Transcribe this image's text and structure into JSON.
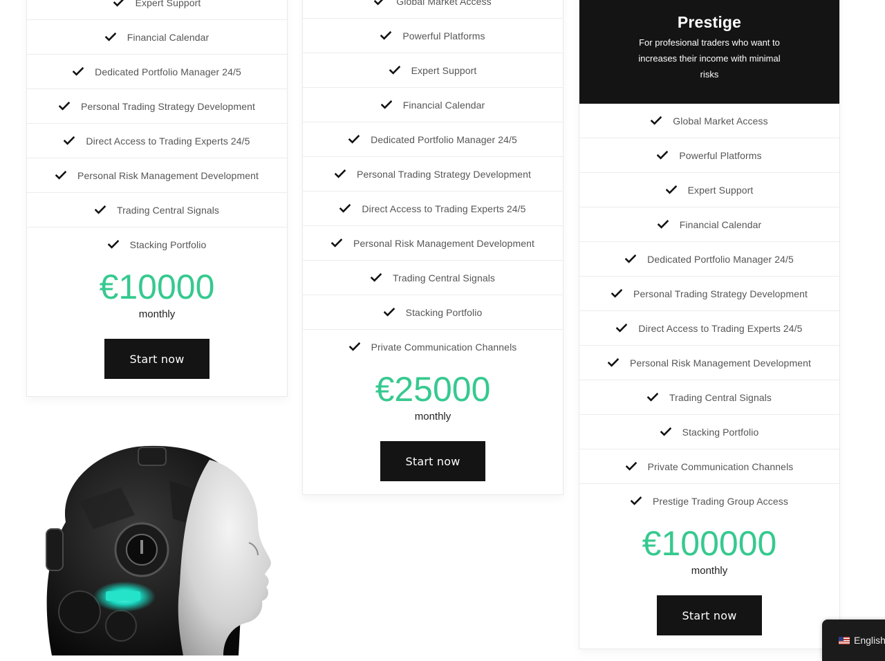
{
  "plans": [
    {
      "features": [
        "Expert Support",
        "Financial Calendar",
        "Dedicated Portfolio Manager 24/5",
        "Personal Trading Strategy Development",
        "Direct Access to Trading Experts 24/5",
        "Personal Risk Management Development",
        "Trading Central Signals",
        "Stacking Portfolio"
      ],
      "price": "€10000",
      "period": "monthly",
      "button": "Start now"
    },
    {
      "features": [
        "Global Market Access",
        "Powerful Platforms",
        "Expert Support",
        "Financial Calendar",
        "Dedicated Portfolio Manager 24/5",
        "Personal Trading Strategy Development",
        "Direct Access to Trading Experts 24/5",
        "Personal Risk Management Development",
        "Trading Central Signals",
        "Stacking Portfolio",
        "Private Communication Channels"
      ],
      "price": "€25000",
      "period": "monthly",
      "button": "Start now"
    },
    {
      "name": "Prestige",
      "description": "For profesional traders who want to increases their income with minimal risks",
      "features": [
        "Global Market Access",
        "Powerful Platforms",
        "Expert Support",
        "Financial Calendar",
        "Dedicated Portfolio Manager 24/5",
        "Personal Trading Strategy Development",
        "Direct Access to Trading Experts 24/5",
        "Personal Risk Management Development",
        "Trading Central Signals",
        "Stacking Portfolio",
        "Private Communication Channels",
        "Prestige Trading Group Access"
      ],
      "price": "€100000",
      "period": "monthly",
      "button": "Start now"
    }
  ],
  "language": {
    "label": "English",
    "flag_icon": "us-flag-icon"
  },
  "colors": {
    "price": "#36c98f",
    "dark": "#141414"
  }
}
